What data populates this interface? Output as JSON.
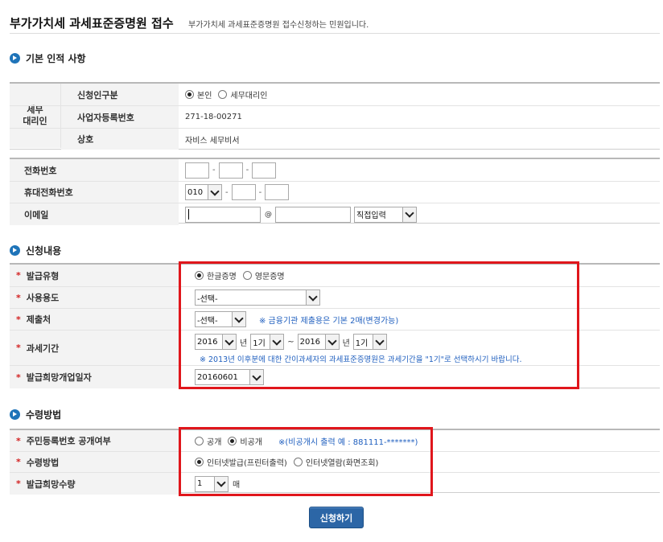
{
  "header": {
    "title": "부가가치세 과세표준증명원 접수",
    "description": "부가가치세 과세표준증명원 접수신청하는 민원입니다."
  },
  "section_basic": {
    "title": "기본 인적 사항",
    "group_label_line1": "세무",
    "group_label_line2": "대리인",
    "applicant_type": {
      "label": "신청인구분",
      "options": [
        "본인",
        "세무대리인"
      ],
      "selected": "본인"
    },
    "biz_number": {
      "label": "사업자등록번호",
      "value": "271-18-00271"
    },
    "company": {
      "label": "상호",
      "value": "자비스 세무비서"
    },
    "phone": {
      "label": "전화번호",
      "dash": "-"
    },
    "mobile": {
      "label": "휴대전화번호",
      "prefix": "010",
      "dash": "-"
    },
    "email": {
      "label": "이메일",
      "at": "@",
      "domain_select": "직접입력"
    }
  },
  "section_request": {
    "title": "신청내용",
    "required_mark": "*",
    "issue_type": {
      "label": "발급유형",
      "options": [
        "한글증명",
        "영문증명"
      ],
      "selected": "한글증명"
    },
    "purpose": {
      "label": "사용용도",
      "value": "-선택-"
    },
    "submit_to": {
      "label": "제출처",
      "value": "-선택-",
      "note": "※ 금융기관 제출용은 기본 2매(변경가능)"
    },
    "period": {
      "label": "과세기간",
      "from_year": "2016",
      "year_unit": "년",
      "from_term": "1기",
      "tilde": "~",
      "to_year": "2016",
      "to_term": "1기",
      "note": "※ 2013년 이후분에 대한 간이과세자의 과세표준증명원은 과세기간을 \"1기\"로 선택하시기 바랍니다."
    },
    "desired_date": {
      "label": "발급희망개업일자",
      "value": "20160601"
    }
  },
  "section_receive": {
    "title": "수령방법",
    "required_mark": "*",
    "id_disclosure": {
      "label": "주민등록번호 공개여부",
      "options": [
        "공개",
        "비공개"
      ],
      "selected": "비공개",
      "note": "※(비공개시 출력 예 : 881111-*******)"
    },
    "method": {
      "label": "수령방법",
      "options": [
        "인터넷발급(프린터출력)",
        "인터넷열람(화면조회)"
      ],
      "selected": "인터넷발급(프린터출력)"
    },
    "quantity": {
      "label": "발급희망수량",
      "value": "1",
      "unit": "매"
    }
  },
  "submit_label": "신청하기",
  "colors": {
    "accent": "#1f74b9",
    "required": "#d21f1f",
    "highlight": "#e0161c",
    "button": "#2c66a6"
  }
}
